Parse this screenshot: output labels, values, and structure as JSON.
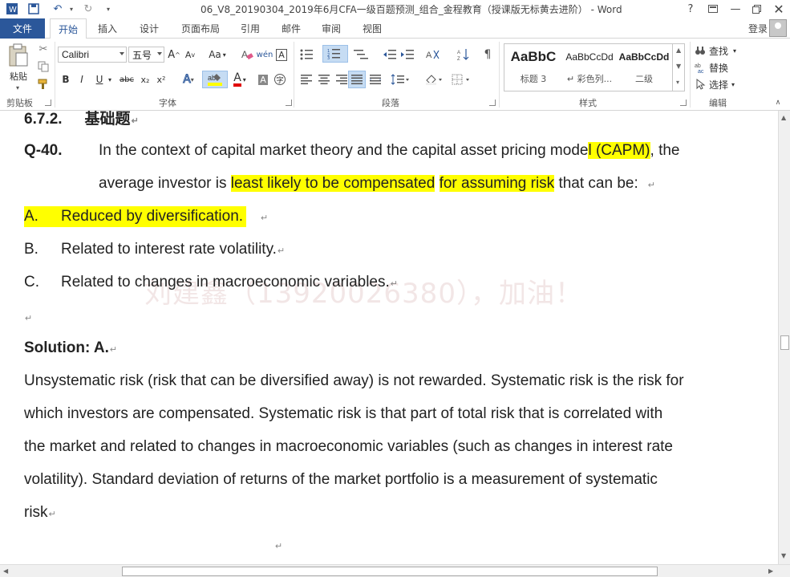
{
  "window": {
    "title": "06_V8_20190304_2019年6月CFA一级百题预测_组合_金程教育（授课版无标黄去进阶） - Word",
    "help": "?",
    "login": "登录"
  },
  "tabs": [
    "文件",
    "开始",
    "插入",
    "设计",
    "页面布局",
    "引用",
    "邮件",
    "审阅",
    "视图"
  ],
  "ribbon": {
    "clipboard": {
      "label": "剪贴板",
      "paste": "粘贴"
    },
    "font": {
      "label": "字体",
      "name": "Calibri",
      "size": "五号",
      "change_case": "Aa",
      "bold": "B",
      "italic": "I",
      "underline": "U",
      "strike": "abc",
      "sub": "x₂",
      "sup": "x²",
      "grow": "A",
      "shrink": "A",
      "clear": "A",
      "char_border": "A",
      "font_color": "A",
      "char_shade": "A",
      "enclose": "字"
    },
    "paragraph": {
      "label": "段落"
    },
    "styles": {
      "label": "样式",
      "items": [
        {
          "sample": "AaBbC",
          "name": "标题 3"
        },
        {
          "sample": "AaBbCcDd",
          "name": "↵ 彩色列..."
        },
        {
          "sample": "AaBbCcDd",
          "name": "二级"
        }
      ]
    },
    "editing": {
      "label": "编辑",
      "find": "查找",
      "replace": "替换",
      "select": "选择"
    }
  },
  "document": {
    "section_number": "6.7.2.",
    "section_title": "基础题",
    "question_id": "Q-40.",
    "q_line1_a": "In the context of capital market theory and the capital asset pricing mode",
    "q_line1_b": "l (CAPM)",
    "q_line1_c": ", the",
    "q_line2_a": "average investor is ",
    "q_line2_b": "least likely to be compensated",
    "q_line2_c": " ",
    "q_line2_d": "for assuming risk",
    "q_line2_e": " that can be:",
    "options": [
      {
        "letter": "A.",
        "text": "Reduced by diversification."
      },
      {
        "letter": "B.",
        "text": "Related to interest rate volatility."
      },
      {
        "letter": "C.",
        "text": "Related to changes in macroeconomic variables."
      }
    ],
    "watermark": "刘建鑫（13920026380），加油！",
    "solution_heading": "Solution: A.",
    "solution_lines": [
      "Unsystematic risk (risk that can be diversified away) is not rewarded. Systematic risk is the risk for",
      "which investors are compensated. Systematic risk is that part of total risk that is correlated with",
      "the market and related to changes in macroeconomic variables (such as changes in interest rate",
      "volatility). Standard deviation of returns of the market portfolio is a measurement of systematic",
      "risk"
    ],
    "para_mark": "↵"
  },
  "colors": {
    "accent": "#2b579a",
    "highlight": "#ffff00"
  }
}
